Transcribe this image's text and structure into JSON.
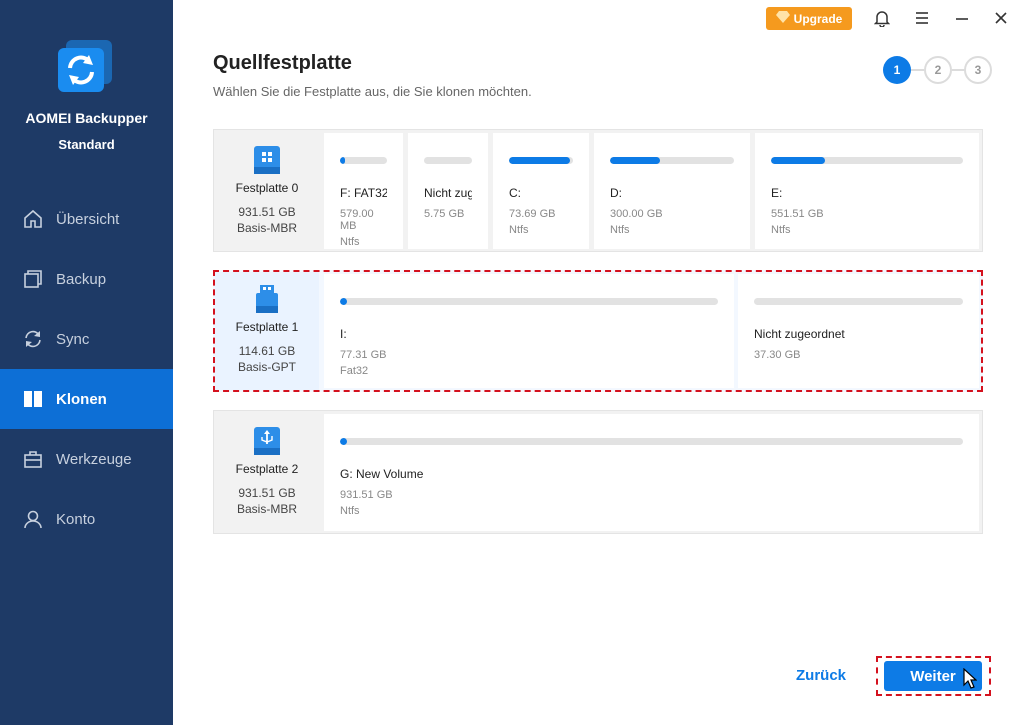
{
  "app": {
    "name_line1": "AOMEI Backupper",
    "name_line2": "Standard"
  },
  "sidebar": {
    "items": [
      {
        "label": "Übersicht",
        "icon": "home-icon",
        "active": false
      },
      {
        "label": "Backup",
        "icon": "backup-icon",
        "active": false
      },
      {
        "label": "Sync",
        "icon": "sync-icon",
        "active": false
      },
      {
        "label": "Klonen",
        "icon": "clone-icon",
        "active": true
      },
      {
        "label": "Werkzeuge",
        "icon": "toolbox-icon",
        "active": false
      },
      {
        "label": "Konto",
        "icon": "user-icon",
        "active": false
      }
    ]
  },
  "header": {
    "upgrade_label": "Upgrade"
  },
  "page": {
    "title": "Quellfestplatte",
    "subtitle": "Wählen Sie die Festplatte aus, die Sie klonen möchten.",
    "steps": [
      "1",
      "2",
      "3"
    ],
    "current_step": 1
  },
  "disks": [
    {
      "name": "Festplatte 0",
      "size": "931.51 GB",
      "type": "Basis-MBR",
      "selected": false,
      "partitions": [
        {
          "name": "F: FAT32",
          "size": "579.00 MB",
          "fs": "Ntfs",
          "used": 0.1
        },
        {
          "name": "Nicht zug...",
          "size": "5.75 GB",
          "fs": "",
          "used": 0
        },
        {
          "name": "C:",
          "size": "73.69 GB",
          "fs": "Ntfs",
          "used": 0.95
        },
        {
          "name": "D:",
          "size": "300.00 GB",
          "fs": "Ntfs",
          "used": 0.4
        },
        {
          "name": "E:",
          "size": "551.51 GB",
          "fs": "Ntfs",
          "used": 0.28
        }
      ]
    },
    {
      "name": "Festplatte 1",
      "size": "114.61 GB",
      "type": "Basis-GPT",
      "selected": true,
      "partitions": [
        {
          "name": "I:",
          "size": "77.31 GB",
          "fs": "Fat32",
          "used": 0.01
        },
        {
          "name": "Nicht zugeordnet",
          "size": "37.30 GB",
          "fs": "",
          "used": 0
        }
      ]
    },
    {
      "name": "Festplatte 2",
      "size": "931.51 GB",
      "type": "Basis-MBR",
      "selected": false,
      "partitions": [
        {
          "name": "G: New Volume",
          "size": "931.51 GB",
          "fs": "Ntfs",
          "used": 0.01
        }
      ]
    }
  ],
  "footer": {
    "back_label": "Zurück",
    "next_label": "Weiter"
  },
  "colors": {
    "sidebar": "#1e3a66",
    "accent": "#0d7be6",
    "upgrade": "#f59a1e",
    "highlight": "#d4111e"
  }
}
